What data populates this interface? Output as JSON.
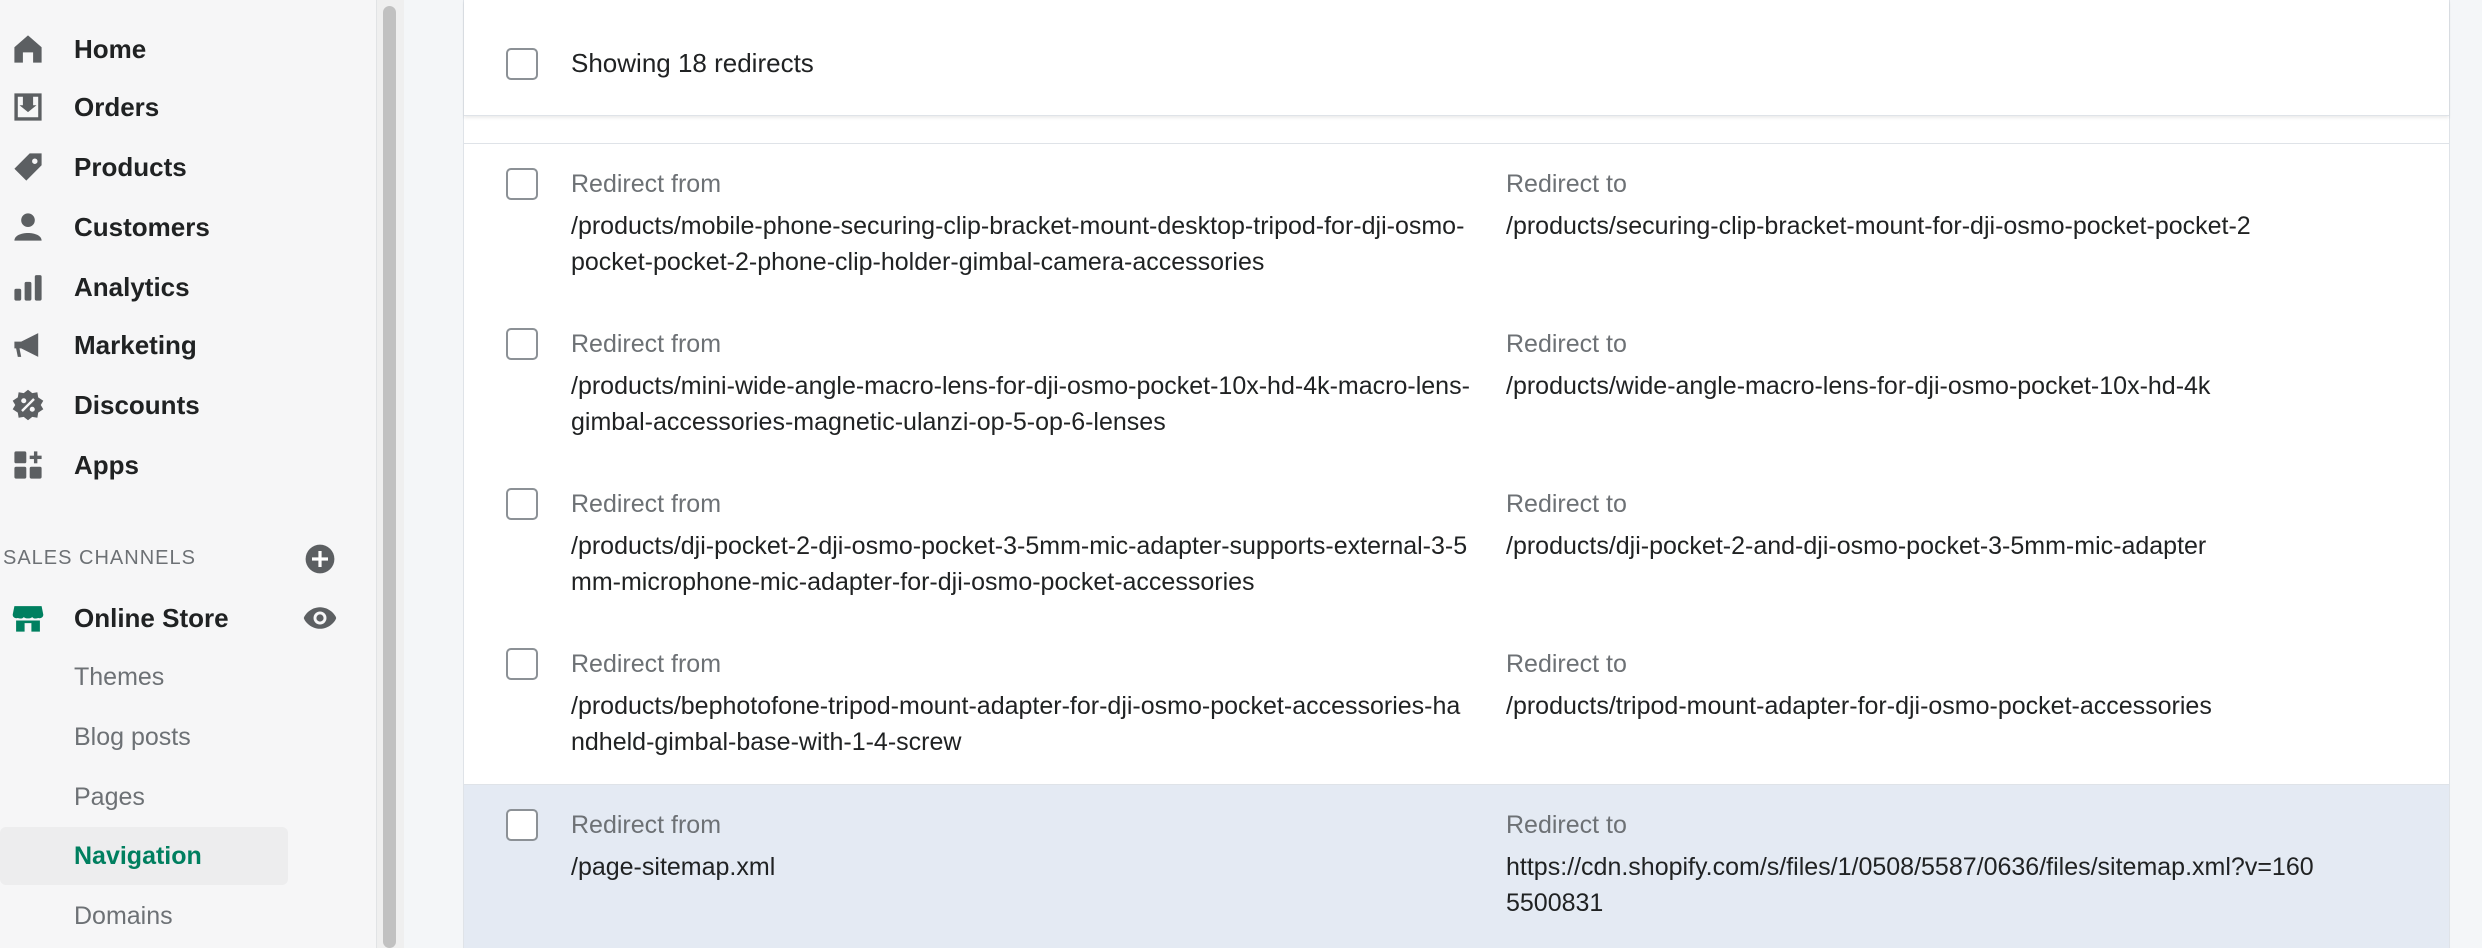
{
  "sidebar": {
    "items": [
      {
        "label": "Home",
        "icon": "home-icon"
      },
      {
        "label": "Orders",
        "icon": "orders-icon"
      },
      {
        "label": "Products",
        "icon": "tag-icon"
      },
      {
        "label": "Customers",
        "icon": "person-icon"
      },
      {
        "label": "Analytics",
        "icon": "bar-chart-icon"
      },
      {
        "label": "Marketing",
        "icon": "megaphone-icon"
      },
      {
        "label": "Discounts",
        "icon": "discount-icon"
      },
      {
        "label": "Apps",
        "icon": "apps-icon"
      }
    ],
    "sales_channels_header": "SALES CHANNELS",
    "online_store": "Online Store",
    "sub_items": [
      {
        "label": "Themes",
        "active": false
      },
      {
        "label": "Blog posts",
        "active": false
      },
      {
        "label": "Pages",
        "active": false
      },
      {
        "label": "Navigation",
        "active": true
      },
      {
        "label": "Domains",
        "active": false
      }
    ]
  },
  "list": {
    "showing_text": "Showing 18 redirects",
    "from_label": "Redirect from",
    "to_label": "Redirect to",
    "rows": [
      {
        "from": "/products/mobile-phone-securing-clip-bracket-mount-desktop-tripod-for-dji-osmo-pocket-pocket-2-phone-clip-holder-gimbal-camera-accessories",
        "to": "/products/securing-clip-bracket-mount-for-dji-osmo-pocket-pocket-2",
        "selected": false
      },
      {
        "from": "/products/mini-wide-angle-macro-lens-for-dji-osmo-pocket-10x-hd-4k-macro-lens-gimbal-accessories-magnetic-ulanzi-op-5-op-6-lenses",
        "to": "/products/wide-angle-macro-lens-for-dji-osmo-pocket-10x-hd-4k",
        "selected": false
      },
      {
        "from": "/products/dji-pocket-2-dji-osmo-pocket-3-5mm-mic-adapter-supports-external-3-5mm-microphone-mic-adapter-for-dji-osmo-pocket-accessories",
        "to": "/products/dji-pocket-2-and-dji-osmo-pocket-3-5mm-mic-adapter",
        "selected": false
      },
      {
        "from": "/products/bephotofone-tripod-mount-adapter-for-dji-osmo-pocket-accessories-handheld-gimbal-base-with-1-4-screw",
        "to": "/products/tripod-mount-adapter-for-dji-osmo-pocket-accessories",
        "selected": false
      },
      {
        "from": "/page-sitemap.xml",
        "to": "https://cdn.shopify.com/s/files/1/0508/5587/0636/files/sitemap.xml?v=1605500831",
        "selected": true
      }
    ]
  },
  "colors": {
    "accent": "#007f5f",
    "selected_row": "#e4eaf3",
    "sidebar_bg": "#f6f6f7"
  }
}
